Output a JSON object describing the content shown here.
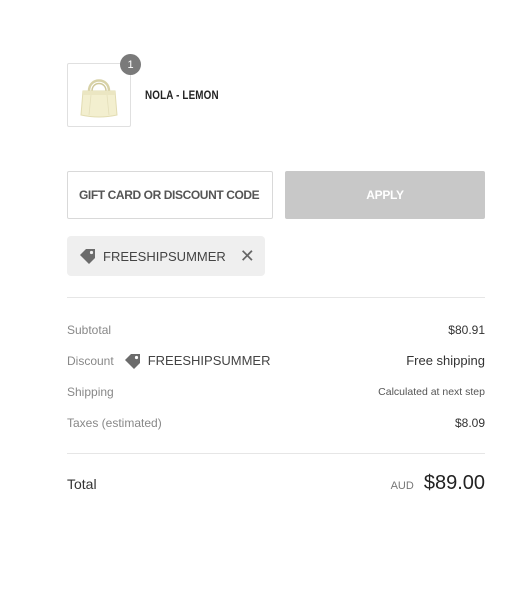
{
  "product": {
    "name": "NOLA - LEMON",
    "quantity": "1",
    "image_icon": "tote-bag-image"
  },
  "discount": {
    "input_placeholder": "GIFT CARD OR DISCOUNT CODE",
    "input_value": "",
    "apply_label": "APPLY",
    "applied_code": "FREESHIPSUMMER",
    "tag_icon": "tag-icon",
    "remove_icon": "close-icon"
  },
  "summary": {
    "subtotal_label": "Subtotal",
    "subtotal_value": "$80.91",
    "discount_label": "Discount",
    "discount_code": "FREESHIPSUMMER",
    "discount_value": "Free shipping",
    "shipping_label": "Shipping",
    "shipping_value": "Calculated at next step",
    "taxes_label": "Taxes (estimated)",
    "taxes_value": "$8.09"
  },
  "total": {
    "label": "Total",
    "currency": "AUD",
    "amount": "$89.00"
  },
  "colors": {
    "apply_button_bg": "#c8c8c8",
    "chip_bg": "#efefef",
    "badge_bg": "#7a7a7a"
  }
}
